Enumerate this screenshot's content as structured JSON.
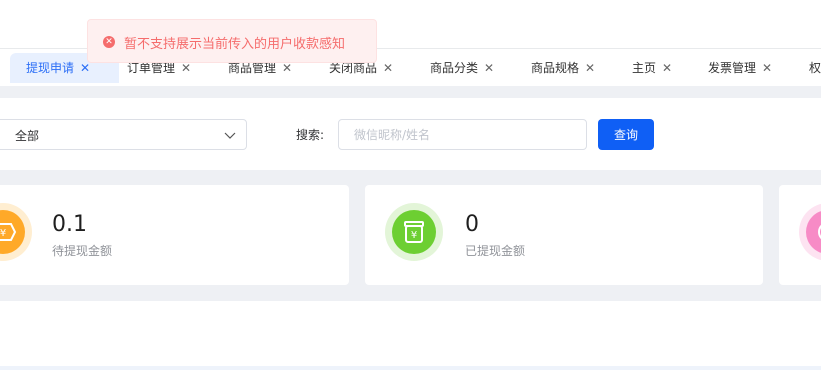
{
  "toast": {
    "message": "暂不支持展示当前传入的用户收款感知"
  },
  "tabs": [
    {
      "label": "提现申请",
      "active": true
    },
    {
      "label": "订单管理"
    },
    {
      "label": "商品管理"
    },
    {
      "label": "关闭商品"
    },
    {
      "label": "商品分类"
    },
    {
      "label": "商品规格"
    },
    {
      "label": "主页"
    },
    {
      "label": "发票管理"
    },
    {
      "label": "权"
    }
  ],
  "filter": {
    "status_value": "全部",
    "search_label": "搜索:",
    "search_placeholder": "微信昵称/姓名",
    "search_value": "",
    "query_button": "查询"
  },
  "stats": [
    {
      "value": "0.1",
      "label": "待提现金额",
      "icon": "yen-tag-icon",
      "color": "#ffa928",
      "ring": "#ffeed1"
    },
    {
      "value": "0",
      "label": "已提现金额",
      "icon": "yen-jar-icon",
      "color": "#6dcf32",
      "ring": "#e3f5d8"
    },
    {
      "value": "",
      "label": "",
      "icon": "stat-icon",
      "color": "#f78bc6",
      "ring": "#fde3f1"
    }
  ]
}
